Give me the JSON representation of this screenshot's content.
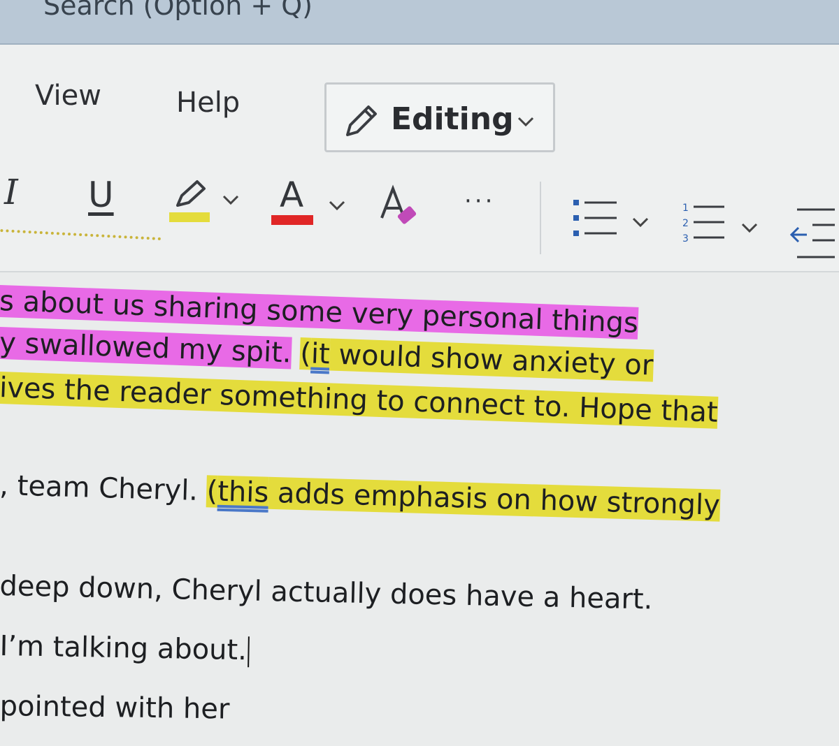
{
  "search": {
    "placeholder": "Search (Option + Q)"
  },
  "menu": {
    "tabs": [
      "View",
      "Help"
    ]
  },
  "mode": {
    "label": "Editing"
  },
  "toolbar": {
    "italic": "I",
    "underline": "U",
    "font_color": "A",
    "more": "···",
    "highlight_color": "#e4dc3c",
    "font_color_swatch": "#e02626"
  },
  "document": {
    "lines": [
      {
        "parts": [
          {
            "text": "s about us sharing some very personal things",
            "hl": "pink"
          }
        ]
      },
      {
        "parts": [
          {
            "text": "y swallowed my spit.",
            "hl": "pink"
          },
          {
            "text": " ",
            "hl": ""
          },
          {
            "text": "(",
            "hl": "yellow"
          },
          {
            "text": "it",
            "hl": "yellow",
            "sq": true
          },
          {
            "text": " would show anxiety or",
            "hl": "yellow"
          }
        ]
      },
      {
        "parts": [
          {
            "text": "ives the reader something to connect to. Hope that",
            "hl": "yellow"
          }
        ]
      },
      {
        "parts": [
          {
            "text": ", team Cheryl. ",
            "hl": ""
          },
          {
            "text": "(",
            "hl": "yellow"
          },
          {
            "text": "this",
            "hl": "yellow",
            "sq": true
          },
          {
            "text": " adds emphasis on how strongly",
            "hl": "yellow"
          }
        ]
      },
      {
        "parts": [
          {
            "text": " deep down, Cheryl actually does have a heart.",
            "hl": ""
          }
        ]
      },
      {
        "parts": [
          {
            "text": " I’m talking about.",
            "hl": "",
            "caret": true
          }
        ]
      },
      {
        "parts": [
          {
            "text": "pointed with her",
            "hl": ""
          }
        ]
      }
    ]
  }
}
